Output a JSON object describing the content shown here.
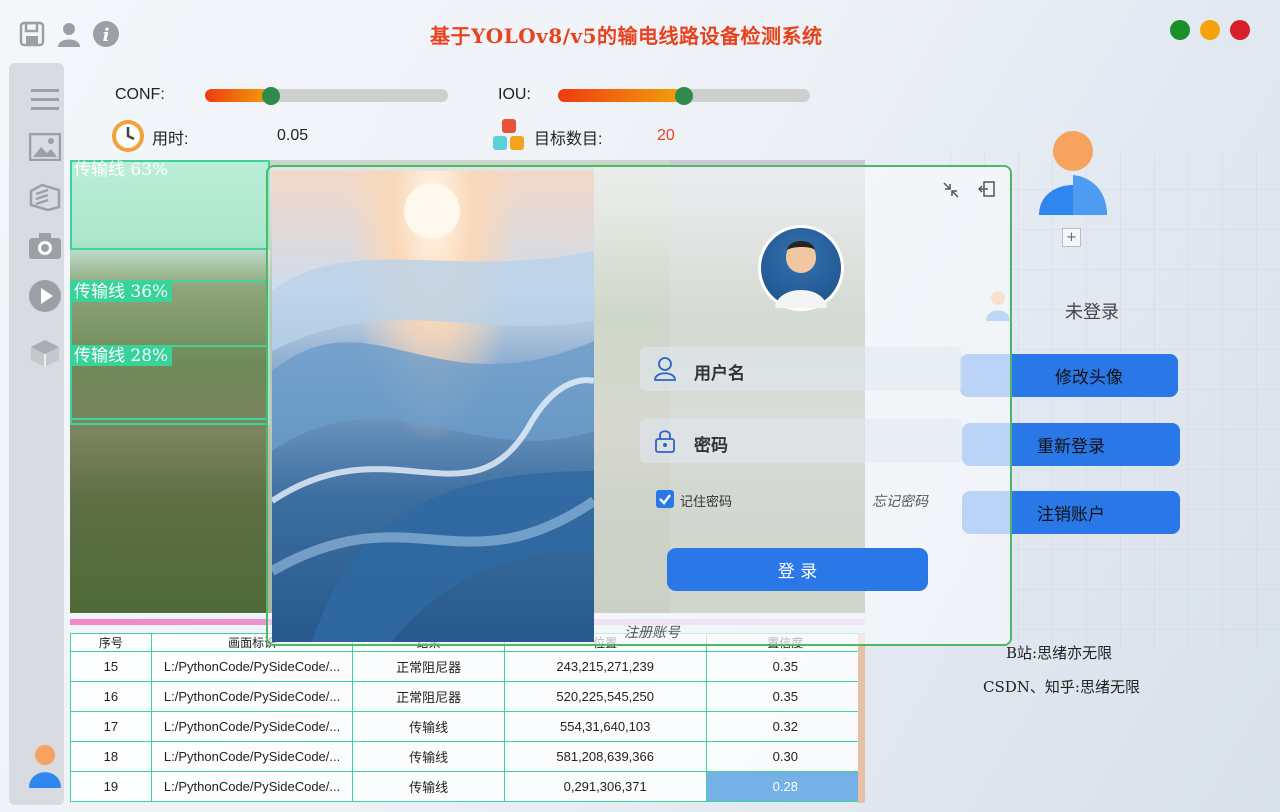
{
  "title": "基于YOLOv8/v5的输电线路设备检测系统",
  "window_colors": {
    "green": "#1b8f2a",
    "yellow": "#f4a40a",
    "red": "#d81e2a"
  },
  "controls": {
    "conf_label": "CONF:",
    "conf_level": 0.27,
    "iou_label": "IOU:",
    "iou_level": 0.5,
    "time_label": "用时:",
    "time_value": "0.05",
    "count_label": "目标数目:",
    "count_value": "20"
  },
  "detections": [
    {
      "label": "传输线 63%"
    },
    {
      "label": "传输线 36%"
    },
    {
      "label": "传输线 28%"
    }
  ],
  "login": {
    "username_placeholder": "用户名",
    "password_placeholder": "密码",
    "remember_label": "记住密码",
    "forgot_label": "忘记密码",
    "login_button": "登 录",
    "register_link": "注册账号"
  },
  "user_panel": {
    "add_label": "+",
    "status": "未登录",
    "change_avatar": "修改头像",
    "relogin": "重新登录",
    "logout_account": "注销账户",
    "bilibili": "B站:思绪亦无限",
    "csdn": "CSDN、知乎:思绪无限"
  },
  "table": {
    "headers": [
      "序号",
      "画面标识",
      "结果",
      "位置",
      "置信度"
    ],
    "rows": [
      [
        "15",
        "L:/PythonCode/PySideCode/...",
        "正常阻尼器",
        "243,215,271,239",
        "0.35"
      ],
      [
        "16",
        "L:/PythonCode/PySideCode/...",
        "正常阻尼器",
        "520,225,545,250",
        "0.35"
      ],
      [
        "17",
        "L:/PythonCode/PySideCode/...",
        "传输线",
        "554,31,640,103",
        "0.32"
      ],
      [
        "18",
        "L:/PythonCode/PySideCode/...",
        "传输线",
        "581,208,639,366",
        "0.30"
      ],
      [
        "19",
        "L:/PythonCode/PySideCode/...",
        "传输线",
        "0,291,306,371",
        "0.28"
      ]
    ]
  }
}
